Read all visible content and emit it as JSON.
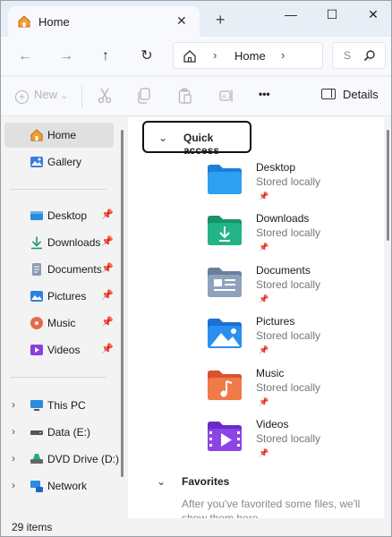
{
  "window": {
    "tab_label": "Home",
    "tab_close": "✕",
    "new_tab": "+",
    "minimize": "—",
    "maximize": "☐",
    "close": "✕"
  },
  "navbar": {
    "back": "←",
    "forward": "→",
    "up": "↑",
    "refresh": "↻",
    "address_chevron": "›",
    "address_text": "Home",
    "search_text": "S"
  },
  "commandbar": {
    "new_label": "New",
    "more": "•••",
    "details_label": "Details"
  },
  "sidebar": {
    "items": [
      {
        "label": "Home",
        "icon": "home-icon",
        "active": true
      },
      {
        "label": "Gallery",
        "icon": "gallery-icon"
      },
      {
        "label": "Desktop",
        "icon": "desktop-icon",
        "pinned": true
      },
      {
        "label": "Downloads",
        "icon": "downloads-icon",
        "pinned": true
      },
      {
        "label": "Documents",
        "icon": "documents-icon",
        "pinned": true
      },
      {
        "label": "Pictures",
        "icon": "pictures-icon",
        "pinned": true
      },
      {
        "label": "Music",
        "icon": "music-icon",
        "pinned": true
      },
      {
        "label": "Videos",
        "icon": "videos-icon",
        "pinned": true
      },
      {
        "label": "This PC",
        "icon": "pc-icon",
        "expandable": true
      },
      {
        "label": "Data (E:)",
        "icon": "drive-icon",
        "expandable": true
      },
      {
        "label": "DVD Drive (D:)",
        "icon": "dvd-icon",
        "expandable": true
      },
      {
        "label": "Network",
        "icon": "network-icon",
        "expandable": true
      }
    ],
    "pin_glyph": "📌",
    "expand_glyph": "›"
  },
  "main": {
    "quick_access": {
      "title": "Quick access",
      "chevron": "⌄",
      "items": [
        {
          "name": "Desktop",
          "status": "Stored locally",
          "icon": "desktop-folder-icon"
        },
        {
          "name": "Downloads",
          "status": "Stored locally",
          "icon": "downloads-folder-icon"
        },
        {
          "name": "Documents",
          "status": "Stored locally",
          "icon": "documents-folder-icon"
        },
        {
          "name": "Pictures",
          "status": "Stored locally",
          "icon": "pictures-folder-icon"
        },
        {
          "name": "Music",
          "status": "Stored locally",
          "icon": "music-folder-icon"
        },
        {
          "name": "Videos",
          "status": "Stored locally",
          "icon": "videos-folder-icon"
        }
      ],
      "pin_glyph": "📌"
    },
    "favorites": {
      "title": "Favorites",
      "chevron": "⌄",
      "empty_text": "After you've favorited some files, we'll show them here."
    }
  },
  "status": {
    "item_count": "29 items"
  }
}
